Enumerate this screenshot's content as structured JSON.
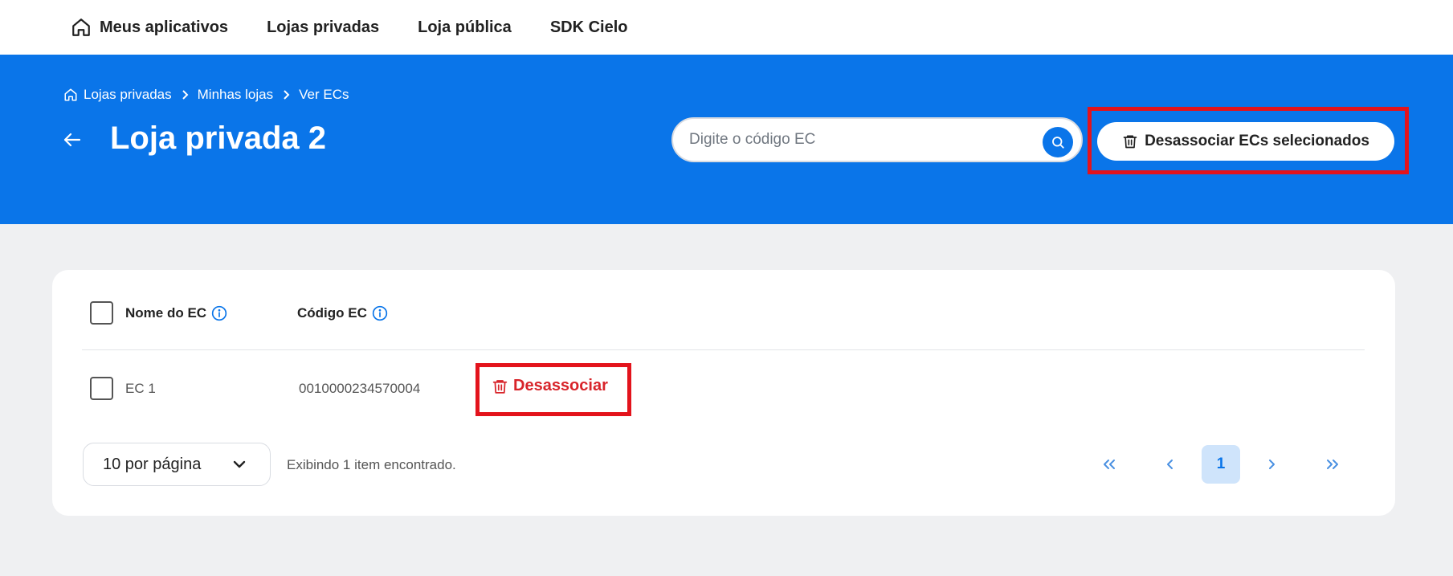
{
  "nav": {
    "items": [
      {
        "label": "Meus aplicativos",
        "icon": "home-icon"
      },
      {
        "label": "Lojas privadas"
      },
      {
        "label": "Loja pública"
      },
      {
        "label": "SDK Cielo"
      }
    ]
  },
  "header": {
    "breadcrumb": [
      "Lojas privadas",
      "Minhas lojas",
      "Ver ECs"
    ],
    "title": "Loja privada 2",
    "search": {
      "placeholder": "Digite o código EC",
      "value": ""
    },
    "disassociate_selected_label": "Desassociar ECs selecionados"
  },
  "table": {
    "columns": [
      "Nome do EC",
      "Código EC"
    ],
    "rows": [
      {
        "name": "EC 1",
        "code": "0010000234570004",
        "action_label": "Desassociar"
      }
    ]
  },
  "footer": {
    "per_page": "10 por página",
    "results_text": "Exibindo 1 item encontrado.",
    "current_page": "1"
  },
  "colors": {
    "primary": "#0a75e9",
    "danger": "#d8242a",
    "highlight": "#e3131c",
    "background": "#eff0f2"
  }
}
